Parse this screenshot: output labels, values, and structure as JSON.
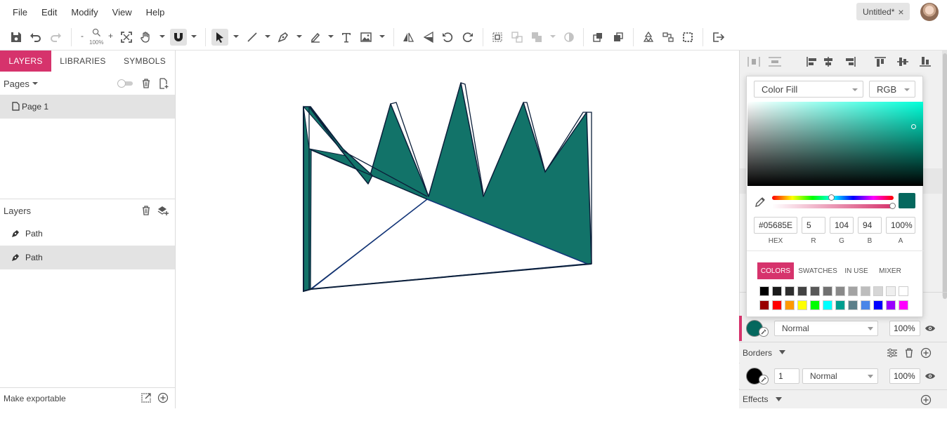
{
  "menubar": {
    "items": [
      "File",
      "Edit",
      "Modify",
      "View",
      "Help"
    ],
    "document_tab": "Untitled*",
    "close_glyph": "×"
  },
  "toolbar": {
    "zoom_out": "-",
    "zoom_in": "+",
    "zoom_level": "100%"
  },
  "left_panel": {
    "tabs": [
      "LAYERS",
      "LIBRARIES",
      "SYMBOLS"
    ],
    "active_tab": "LAYERS",
    "pages_label": "Pages",
    "pages": [
      "Page 1"
    ],
    "layers_label": "Layers",
    "layers": [
      "Path",
      "Path"
    ],
    "selected_layer_index": 1,
    "footer": "Make exportable"
  },
  "color_picker": {
    "fill_type": "Color Fill",
    "color_model": "RGB",
    "hex": "#05685E",
    "r": "5",
    "g": "104",
    "b": "94",
    "a": "100%",
    "labels": {
      "hex": "HEX",
      "r": "R",
      "g": "G",
      "b": "B",
      "a": "A"
    },
    "tabs": [
      "COLORS",
      "SWATCHES",
      "IN USE",
      "MIXER"
    ],
    "active_tab": "COLORS",
    "swatches_row1": [
      "#000000",
      "#1a1a1a",
      "#2e2e2e",
      "#434343",
      "#595959",
      "#707070",
      "#898989",
      "#a3a3a3",
      "#bdbdbd",
      "#d6d6d6",
      "#efefef",
      "#ffffff"
    ],
    "swatches_row2": [
      "#990000",
      "#ff0000",
      "#ff9900",
      "#ffff00",
      "#00ff00",
      "#00ffff",
      "#009e8f",
      "#5c7f89",
      "#4a86e8",
      "#0000ff",
      "#9900ff",
      "#ff00ff"
    ]
  },
  "right_panel": {
    "fill_blend": "Normal",
    "fill_opacity": "100%",
    "borders_label": "Borders",
    "border_width": "1",
    "border_blend": "Normal",
    "border_opacity": "100%",
    "effects_label": "Effects",
    "fill_color": "#05685e",
    "border_color": "#000000"
  },
  "canvas": {
    "shape_fill": "#127369",
    "shape_stroke": "#0b1f3a"
  }
}
